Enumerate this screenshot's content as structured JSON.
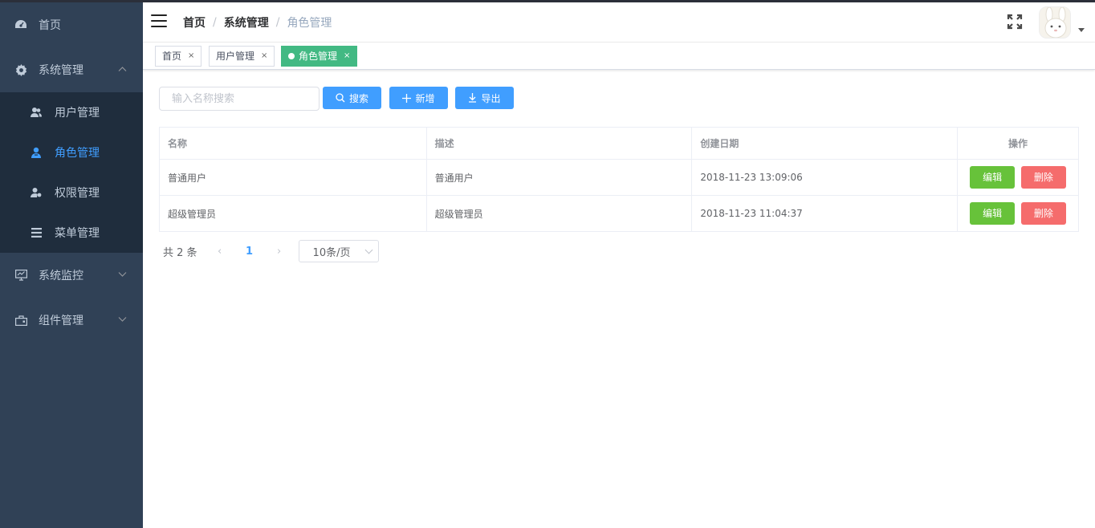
{
  "sidebar": {
    "items": [
      {
        "label": "首页",
        "icon": "dashboard-icon"
      },
      {
        "label": "系统管理",
        "icon": "gear-icon",
        "expanded": true,
        "children": [
          {
            "label": "用户管理",
            "icon": "users-icon"
          },
          {
            "label": "角色管理",
            "icon": "role-icon",
            "active": true
          },
          {
            "label": "权限管理",
            "icon": "permission-icon"
          },
          {
            "label": "菜单管理",
            "icon": "menu-list-icon"
          }
        ]
      },
      {
        "label": "系统监控",
        "icon": "monitor-icon"
      },
      {
        "label": "组件管理",
        "icon": "component-icon"
      }
    ]
  },
  "navbar": {
    "breadcrumb": [
      "首页",
      "系统管理",
      "角色管理"
    ],
    "breadcrumb_sep": "/"
  },
  "tags": [
    {
      "label": "首页"
    },
    {
      "label": "用户管理"
    },
    {
      "label": "角色管理",
      "active": true
    }
  ],
  "tag_close": "×",
  "toolbar": {
    "search_placeholder": "输入名称搜索",
    "search_label": "搜索",
    "add_label": "新增",
    "export_label": "导出"
  },
  "table": {
    "headers": [
      "名称",
      "描述",
      "创建日期",
      "操作"
    ],
    "rows": [
      {
        "name": "普通用户",
        "desc": "普通用户",
        "date": "2018-11-23 13:09:06"
      },
      {
        "name": "超级管理员",
        "desc": "超级管理员",
        "date": "2018-11-23 11:04:37"
      }
    ],
    "edit_label": "编辑",
    "delete_label": "删除"
  },
  "pagination": {
    "total": "共 2 条",
    "current": "1",
    "prev": "‹",
    "next": "›",
    "page_size": "10条/页"
  },
  "colors": {
    "sidebar_bg": "#304156",
    "submenu_bg": "#1f2d3d",
    "primary": "#409eff",
    "tag_active": "#42b983",
    "edit": "#67c23a",
    "delete": "#f56c6c"
  }
}
